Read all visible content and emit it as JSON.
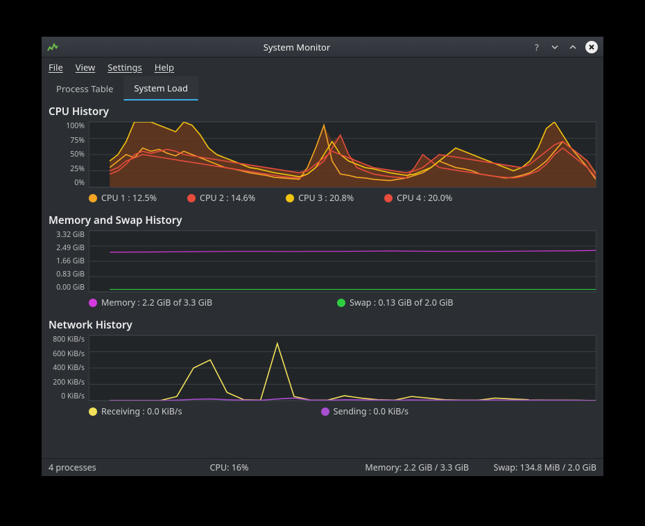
{
  "window": {
    "title": "System Monitor"
  },
  "menus": {
    "file": "File",
    "view": "View",
    "settings": "Settings",
    "help": "Help"
  },
  "tabs": {
    "process": "Process Table",
    "load": "System Load"
  },
  "cpu": {
    "title": "CPU History",
    "ticks": [
      "100%",
      "75%",
      "50%",
      "25%",
      "0%"
    ],
    "legend": [
      {
        "color": "#f5a623",
        "label": "CPU 1 : 12.5%"
      },
      {
        "color": "#e74c3c",
        "label": "CPU 2 : 14.6%"
      },
      {
        "color": "#f1c40f",
        "label": "CPU 3 : 20.8%"
      },
      {
        "color": "#e74c3c",
        "label": "CPU 4 : 20.0%"
      }
    ]
  },
  "mem": {
    "title": "Memory and Swap History",
    "ticks": [
      "3.32 GiB",
      "2.49 GiB",
      "1.66 GiB",
      "0.83 GiB",
      "0.00 GiB"
    ],
    "legend": [
      {
        "color": "#d63adf",
        "label": "Memory : 2.2 GiB of 3.3 GiB"
      },
      {
        "color": "#2ecc40",
        "label": "Swap : 0.13 GiB of 2.0 GiB"
      }
    ]
  },
  "net": {
    "title": "Network History",
    "ticks": [
      "800 KiB/s",
      "600 KiB/s",
      "400 KiB/s",
      "200 KiB/s",
      "0 KiB/s"
    ],
    "legend": [
      {
        "color": "#f1e05a",
        "label": "Receiving : 0.0 KiB/s"
      },
      {
        "color": "#a94fd1",
        "label": "Sending : 0.0 KiB/s"
      }
    ]
  },
  "status": {
    "procs": "4 processes",
    "cpu": "CPU: 16%",
    "mem": "Memory: 2.2 GiB / 3.3 GiB",
    "swap": "Swap: 134.8 MiB / 2.0 GiB"
  },
  "chart_data": [
    {
      "type": "line",
      "title": "CPU History",
      "ylabel": "%",
      "ylim": [
        0,
        100
      ],
      "x": [
        0,
        1,
        2,
        3,
        4,
        5,
        6,
        7,
        8,
        9,
        10,
        11,
        12,
        13,
        14,
        15,
        16,
        17,
        18,
        19,
        20,
        21,
        22,
        23,
        24,
        25,
        26,
        27,
        28,
        29,
        30,
        31,
        32,
        33,
        34,
        35,
        36,
        37,
        38,
        39,
        40,
        41,
        42,
        43,
        44,
        45,
        46,
        47,
        48,
        49,
        50,
        51,
        52,
        53,
        54,
        55,
        56,
        57,
        58,
        59
      ],
      "series": [
        {
          "name": "CPU 1",
          "color": "#f5a623",
          "values": [
            30,
            40,
            50,
            45,
            60,
            55,
            58,
            52,
            48,
            55,
            50,
            45,
            40,
            35,
            30,
            28,
            25,
            22,
            20,
            18,
            15,
            14,
            13,
            12,
            30,
            60,
            95,
            40,
            20,
            18,
            15,
            14,
            12,
            11,
            10,
            12,
            14,
            18,
            22,
            30,
            40,
            35,
            30,
            28,
            25,
            20,
            18,
            16,
            14,
            15,
            18,
            22,
            30,
            40,
            55,
            70,
            60,
            45,
            30,
            12
          ]
        },
        {
          "name": "CPU 2",
          "color": "#e74c3c",
          "values": [
            25,
            30,
            40,
            45,
            50,
            48,
            46,
            44,
            42,
            40,
            38,
            36,
            34,
            32,
            30,
            28,
            26,
            24,
            22,
            20,
            18,
            16,
            15,
            14,
            20,
            30,
            40,
            60,
            80,
            50,
            30,
            25,
            20,
            18,
            16,
            15,
            14,
            30,
            50,
            40,
            30,
            28,
            26,
            24,
            22,
            20,
            18,
            16,
            15,
            14,
            16,
            20,
            25,
            35,
            50,
            60,
            50,
            40,
            30,
            15
          ]
        },
        {
          "name": "CPU 3",
          "color": "#f1c40f",
          "values": [
            40,
            50,
            70,
            100,
            100,
            100,
            95,
            90,
            85,
            100,
            95,
            80,
            60,
            50,
            45,
            40,
            35,
            30,
            28,
            25,
            22,
            20,
            18,
            16,
            20,
            30,
            50,
            70,
            50,
            40,
            35,
            30,
            28,
            25,
            22,
            20,
            18,
            20,
            25,
            30,
            40,
            50,
            60,
            55,
            50,
            45,
            40,
            35,
            30,
            25,
            30,
            40,
            60,
            90,
            100,
            80,
            60,
            50,
            40,
            21
          ]
        },
        {
          "name": "CPU 4",
          "color": "#e74c3c",
          "values": [
            20,
            25,
            35,
            50,
            55,
            52,
            55,
            58,
            55,
            50,
            48,
            46,
            44,
            42,
            40,
            38,
            36,
            34,
            32,
            30,
            28,
            26,
            24,
            22,
            25,
            35,
            45,
            55,
            50,
            45,
            40,
            35,
            30,
            28,
            26,
            24,
            22,
            25,
            30,
            40,
            50,
            48,
            46,
            44,
            42,
            40,
            38,
            36,
            34,
            32,
            30,
            35,
            45,
            55,
            65,
            70,
            60,
            50,
            40,
            20
          ]
        }
      ]
    },
    {
      "type": "line",
      "title": "Memory and Swap History",
      "ylabel": "GiB",
      "ylim": [
        0,
        3.32
      ],
      "x": [
        0,
        1,
        2,
        3,
        4,
        5,
        6,
        7,
        8,
        9,
        10,
        11,
        12,
        13,
        14,
        15,
        16,
        17,
        18,
        19
      ],
      "series": [
        {
          "name": "Memory",
          "color": "#d63adf",
          "values": [
            2.15,
            2.16,
            2.17,
            2.18,
            2.19,
            2.2,
            2.2,
            2.19,
            2.2,
            2.2,
            2.21,
            2.22,
            2.21,
            2.2,
            2.2,
            2.2,
            2.21,
            2.22,
            2.23,
            2.25
          ]
        },
        {
          "name": "Swap",
          "color": "#2ecc40",
          "values": [
            0.13,
            0.13,
            0.13,
            0.13,
            0.13,
            0.13,
            0.13,
            0.13,
            0.13,
            0.13,
            0.13,
            0.13,
            0.13,
            0.13,
            0.13,
            0.13,
            0.13,
            0.13,
            0.13,
            0.13
          ]
        }
      ]
    },
    {
      "type": "line",
      "title": "Network History",
      "ylabel": "KiB/s",
      "ylim": [
        0,
        800
      ],
      "x": [
        0,
        1,
        2,
        3,
        4,
        5,
        6,
        7,
        8,
        9,
        10,
        11,
        12,
        13,
        14,
        15,
        16,
        17,
        18,
        19,
        20,
        21,
        22,
        23,
        24,
        25,
        26,
        27,
        28,
        29
      ],
      "series": [
        {
          "name": "Receiving",
          "color": "#f1e05a",
          "values": [
            0,
            0,
            0,
            0,
            50,
            400,
            500,
            100,
            10,
            5,
            700,
            50,
            5,
            5,
            60,
            30,
            10,
            5,
            50,
            30,
            10,
            5,
            5,
            30,
            20,
            10,
            5,
            5,
            4,
            0
          ]
        },
        {
          "name": "Sending",
          "color": "#a94fd1",
          "values": [
            0,
            0,
            0,
            0,
            5,
            15,
            20,
            10,
            5,
            3,
            20,
            30,
            5,
            3,
            10,
            8,
            5,
            3,
            8,
            6,
            4,
            3,
            3,
            6,
            5,
            4,
            3,
            3,
            2,
            0
          ]
        }
      ]
    }
  ]
}
